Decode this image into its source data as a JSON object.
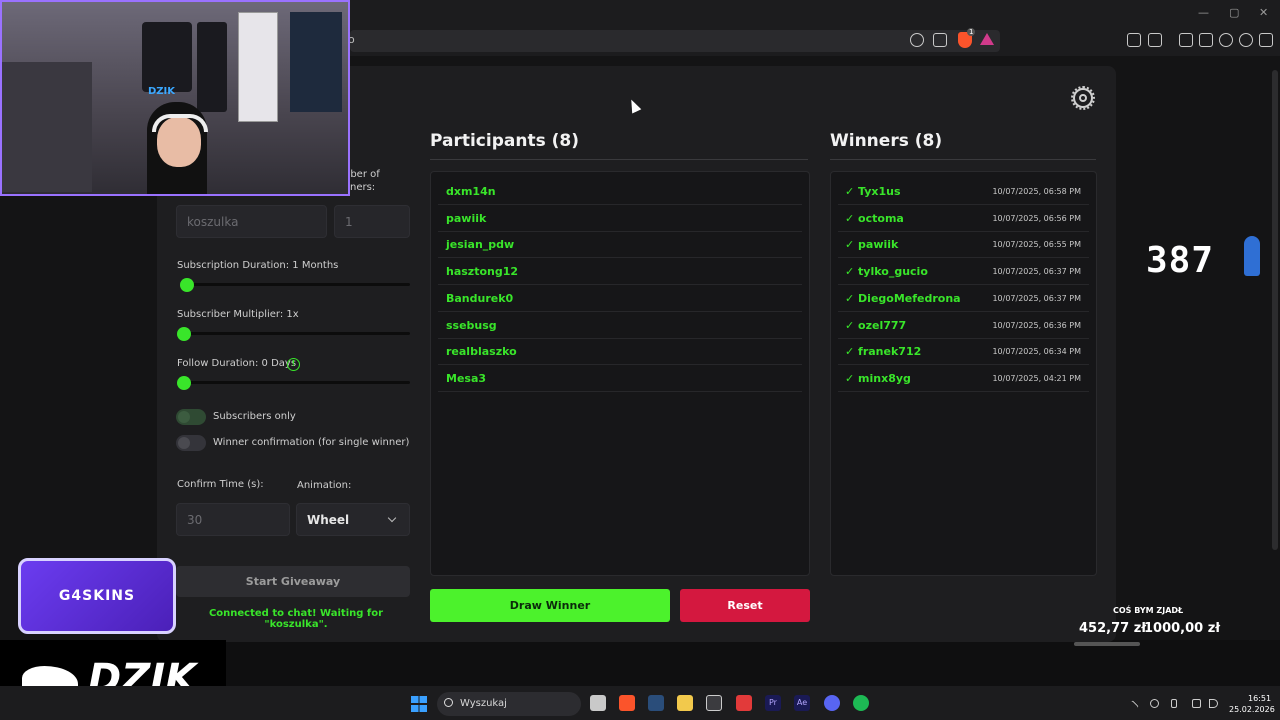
{
  "browser": {
    "url_fragment": "o",
    "window_controls": [
      "—",
      "▢",
      "✕"
    ]
  },
  "participants": {
    "title": "Participants (8)",
    "items": [
      "dxm14n",
      "pawiik",
      "jesian_pdw",
      "hasztong12",
      "Bandurek0",
      "ssebusg",
      "realblaszko",
      "Mesa3"
    ]
  },
  "winners": {
    "title": "Winners (8)",
    "items": [
      {
        "name": "✓ Tyx1us",
        "time": "10/07/2025, 06:58 PM"
      },
      {
        "name": "✓ octoma",
        "time": "10/07/2025, 06:56 PM"
      },
      {
        "name": "✓ pawiik",
        "time": "10/07/2025, 06:55 PM"
      },
      {
        "name": "✓ tylko_gucio",
        "time": "10/07/2025, 06:37 PM"
      },
      {
        "name": "✓ DiegoMefedrona",
        "time": "10/07/2025, 06:37 PM"
      },
      {
        "name": "✓ ozel777",
        "time": "10/07/2025, 06:36 PM"
      },
      {
        "name": "✓ franek712",
        "time": "10/07/2025, 06:34 PM"
      },
      {
        "name": "✓ minx8yg",
        "time": "10/07/2025, 04:21 PM"
      }
    ]
  },
  "settings": {
    "winners_label_part1": "nber of",
    "winners_label_part2": "ners:",
    "keyword_value": "koszulka",
    "winners_count": "1",
    "subscription_duration": "Subscription Duration: 1 Months",
    "subscription_level": 0,
    "subscriber_multiplier": "Subscriber Multiplier: 1x",
    "multiplier_level": 0,
    "follow_duration": "Follow Duration: 0 Days",
    "follow_level": 0,
    "info_glyph": "!",
    "subscribers_only": "Subscribers only",
    "winner_confirmation": "Winner confirmation (for single winner)",
    "confirm_time_label": "Confirm Time (s):",
    "confirm_time_placeholder": "30",
    "animation_label": "Animation:",
    "animation_value": "Wheel",
    "start_button": "Start Giveaway",
    "status": "Connected to chat! Waiting for \"koszulka\"."
  },
  "actions": {
    "draw": "Draw Winner",
    "reset": "Reset"
  },
  "overlay": {
    "counter": "387",
    "sponsor": "G4SKINS",
    "brand": "DZIK",
    "webcam_logo": "DZIK",
    "goal_title": "COŚ BYM ZJADŁ",
    "goal_current": "452,77 zł",
    "goal_target": "1000,00 zł"
  },
  "taskbar": {
    "search_label": "Wyszukaj",
    "time": "16:51",
    "date": "25.02.2026"
  },
  "colors": {
    "accent_green": "#39e52a",
    "draw_button": "#4cf22c",
    "reset_button": "#d4183f",
    "webcam_border": "#9a72ff"
  }
}
